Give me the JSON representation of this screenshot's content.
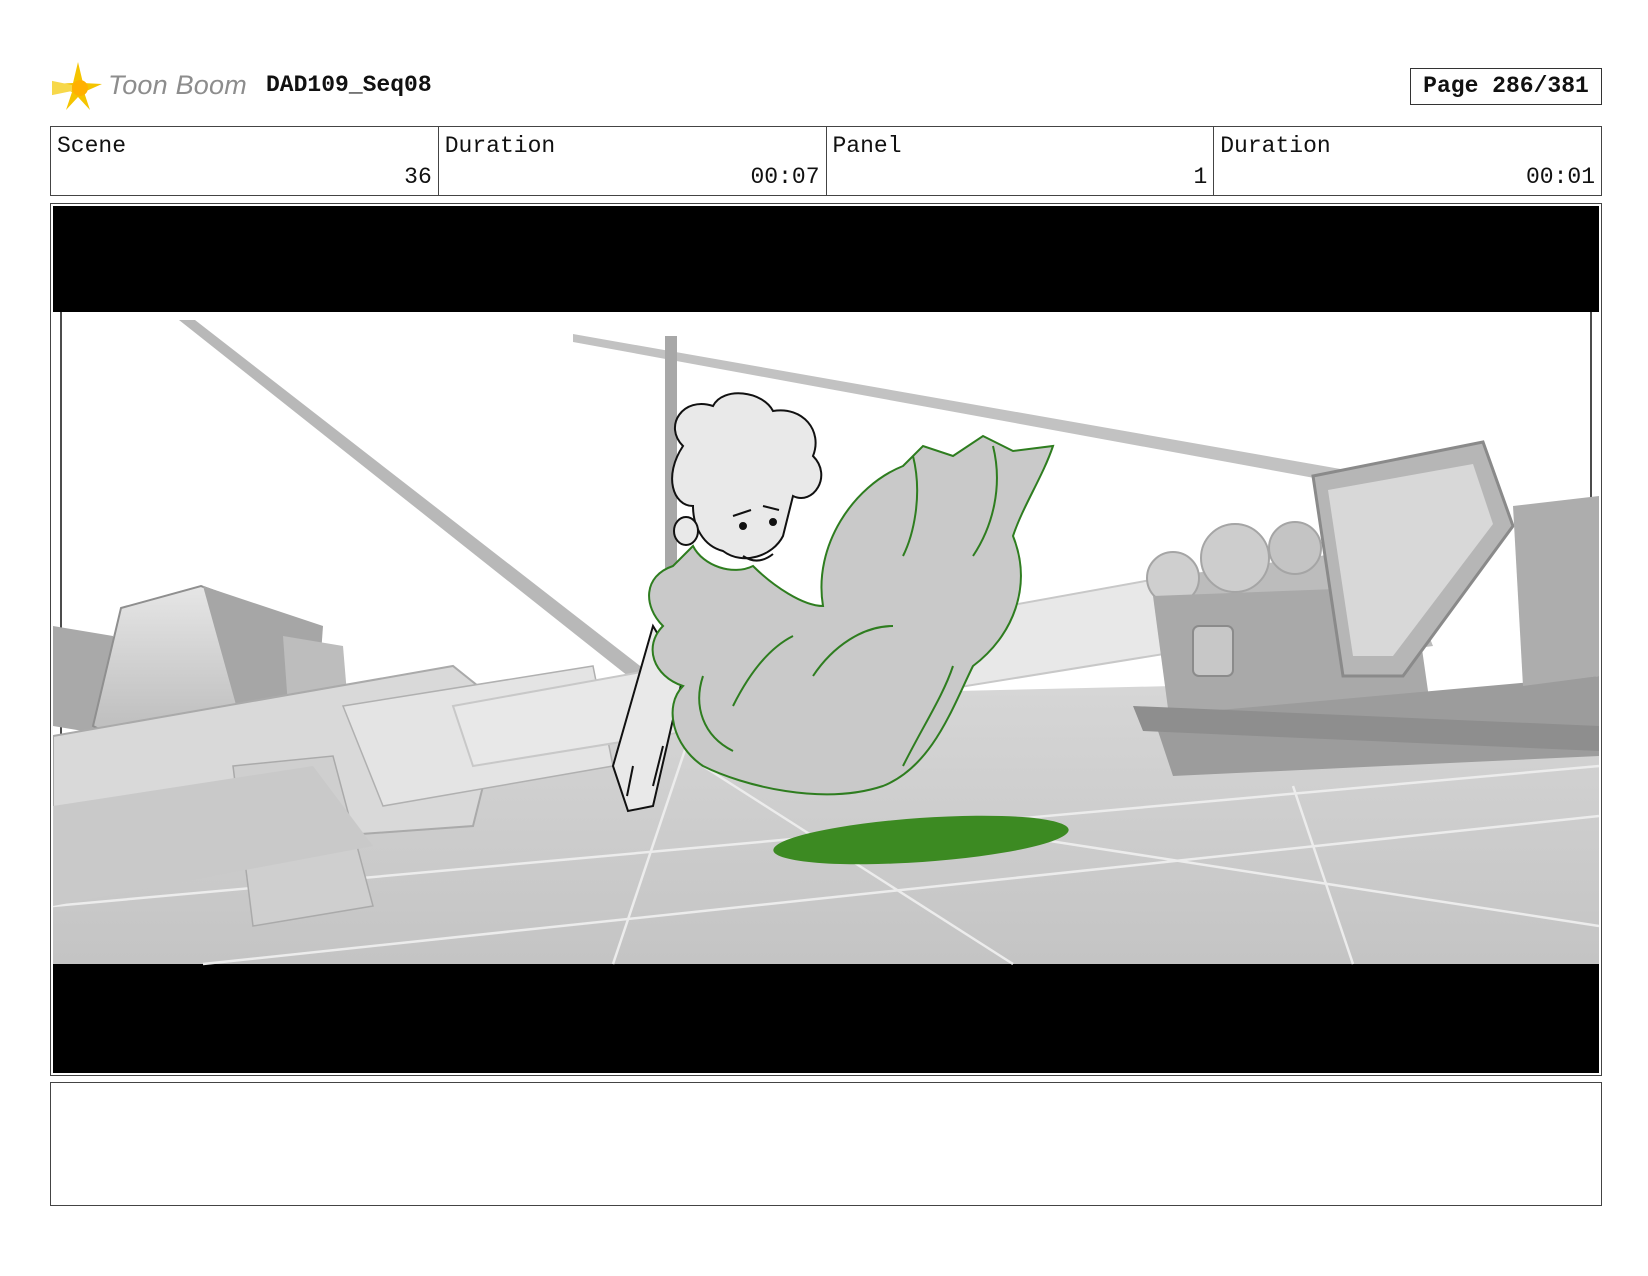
{
  "header": {
    "logo_text": "Toon Boom",
    "project": "DAD109_Seq08",
    "page_label": "Page 286/381"
  },
  "info": {
    "scene_label": "Scene",
    "scene_value": "36",
    "scene_duration_label": "Duration",
    "scene_duration_value": "00:07",
    "panel_label": "Panel",
    "panel_value": "1",
    "panel_duration_label": "Duration",
    "panel_duration_value": "00:01"
  },
  "panel": {
    "letterbox_color": "#000000",
    "character_line_color": "#2e7d1f",
    "shadow_color": "#3c8a22"
  },
  "notes": {
    "text": ""
  }
}
